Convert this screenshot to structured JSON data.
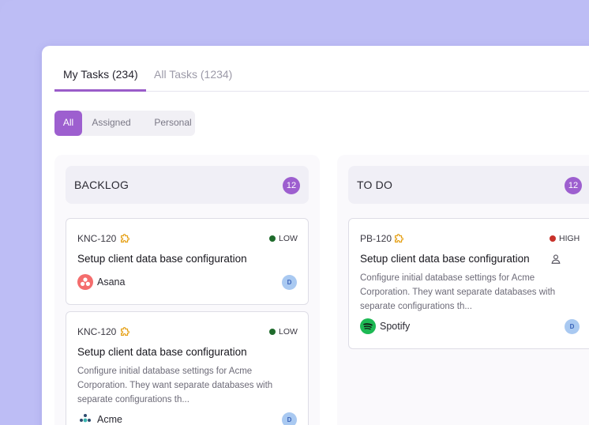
{
  "tabs": [
    {
      "label": "My Tasks (234)",
      "active": true
    },
    {
      "label": "All Tasks (1234)",
      "active": false
    }
  ],
  "filters": {
    "options": [
      "All",
      "Assigned",
      "Personal"
    ],
    "selected": "All"
  },
  "colors": {
    "accent": "#9d5fcf",
    "low": "#1f6b2c",
    "high": "#c8322a",
    "background": "#bdbdf5"
  },
  "columns": [
    {
      "title": "BACKLOG",
      "count": "12",
      "cards": [
        {
          "id": "KNC-120",
          "icon": "puzzle-icon",
          "priority": "LOW",
          "title": "Setup client data base configuration",
          "description": "",
          "company": "Asana",
          "avatar": "D"
        },
        {
          "id": "KNC-120",
          "icon": "puzzle-icon",
          "priority": "LOW",
          "title": "Setup client data base configuration",
          "description": "Configure initial database settings for Acme Corporation. They want separate databases with separate configurations th...",
          "company": "Acme",
          "avatar": "D"
        }
      ]
    },
    {
      "title": "TO DO",
      "count": "12",
      "cards": [
        {
          "id": "PB-120",
          "icon": "puzzle-icon",
          "priority": "HIGH",
          "title": "Setup client data base configuration",
          "description": "Configure initial database settings for Acme Corporation. They want separate databases with separate configurations th...",
          "company": "Spotify",
          "avatar": "D"
        }
      ]
    }
  ]
}
